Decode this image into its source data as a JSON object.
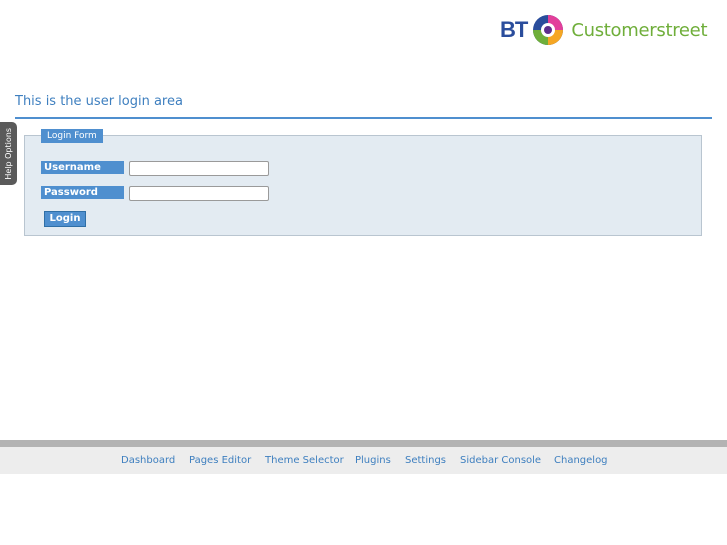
{
  "brand": {
    "bt": "BT",
    "name": "Customerstreet",
    "colors": {
      "bt_blue": "#2a4d9c",
      "green": "#6fae3a"
    }
  },
  "page": {
    "title": "This is the user login area"
  },
  "help_tab": {
    "label": "Help Options"
  },
  "login_form": {
    "legend": "Login Form",
    "username_label": "Username",
    "username_value": "",
    "password_label": "Password",
    "password_value": "",
    "submit_label": "Login"
  },
  "footer": {
    "links": [
      "Dashboard",
      "Pages Editor",
      "Theme Selector",
      "Plugins",
      "Settings",
      "Sidebar Console",
      "Changelog"
    ]
  },
  "colors": {
    "accent": "#4f8fcf",
    "link": "#3e7fbf",
    "form_bg": "#e3ebf2"
  }
}
